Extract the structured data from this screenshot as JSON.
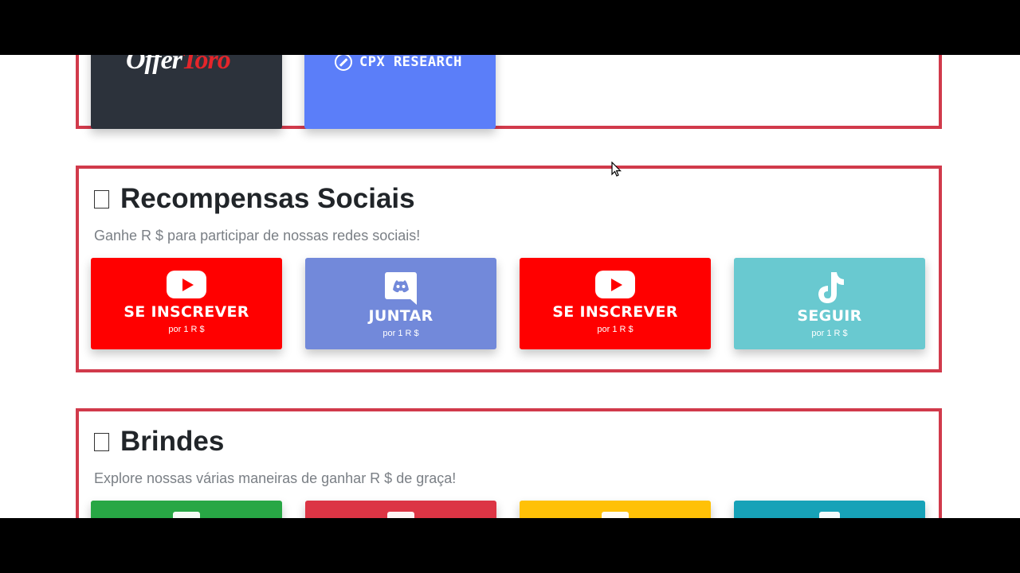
{
  "top_section": {
    "cards": [
      {
        "name": "offertoro",
        "logo_part1": "Offer",
        "logo_part2": "Toro",
        "bg": "#2c323b"
      },
      {
        "name": "cpx-research",
        "logo_text": "CPX RESEARCH",
        "bg": "#5b7ef9"
      }
    ]
  },
  "social_rewards": {
    "title": "Recompensas Sociais",
    "subtitle": "Ganhe R $ para participar de nossas redes sociais!",
    "cards": [
      {
        "icon": "youtube-icon",
        "label": "SE INSCREVER",
        "reward": "por 1 R $",
        "bg": "#ff0000"
      },
      {
        "icon": "discord-icon",
        "label": "JUNTAR",
        "reward": "por 1 R $",
        "bg": "#7289da"
      },
      {
        "icon": "youtube-icon",
        "label": "SE INSCREVER",
        "reward": "por 1 R $",
        "bg": "#ff0000"
      },
      {
        "icon": "tiktok-icon",
        "label": "SEGUIR",
        "reward": "por 1 R $",
        "bg": "#69c9d0"
      }
    ]
  },
  "gifts": {
    "title": "Brindes",
    "subtitle": "Explore nossas várias maneiras de ganhar R $ de graça!",
    "cards": [
      {
        "icon": "users-icon",
        "bg": "#28a745"
      },
      {
        "icon": "gift-box-icon",
        "bg": "#dc3545"
      },
      {
        "icon": "card-icon",
        "bg": "#ffc107"
      },
      {
        "icon": "badge-icon",
        "bg": "#17a2b8"
      }
    ]
  },
  "colors": {
    "section_border": "#d13a4b",
    "title_text": "#212529",
    "subtitle_text": "#7a7f85"
  }
}
